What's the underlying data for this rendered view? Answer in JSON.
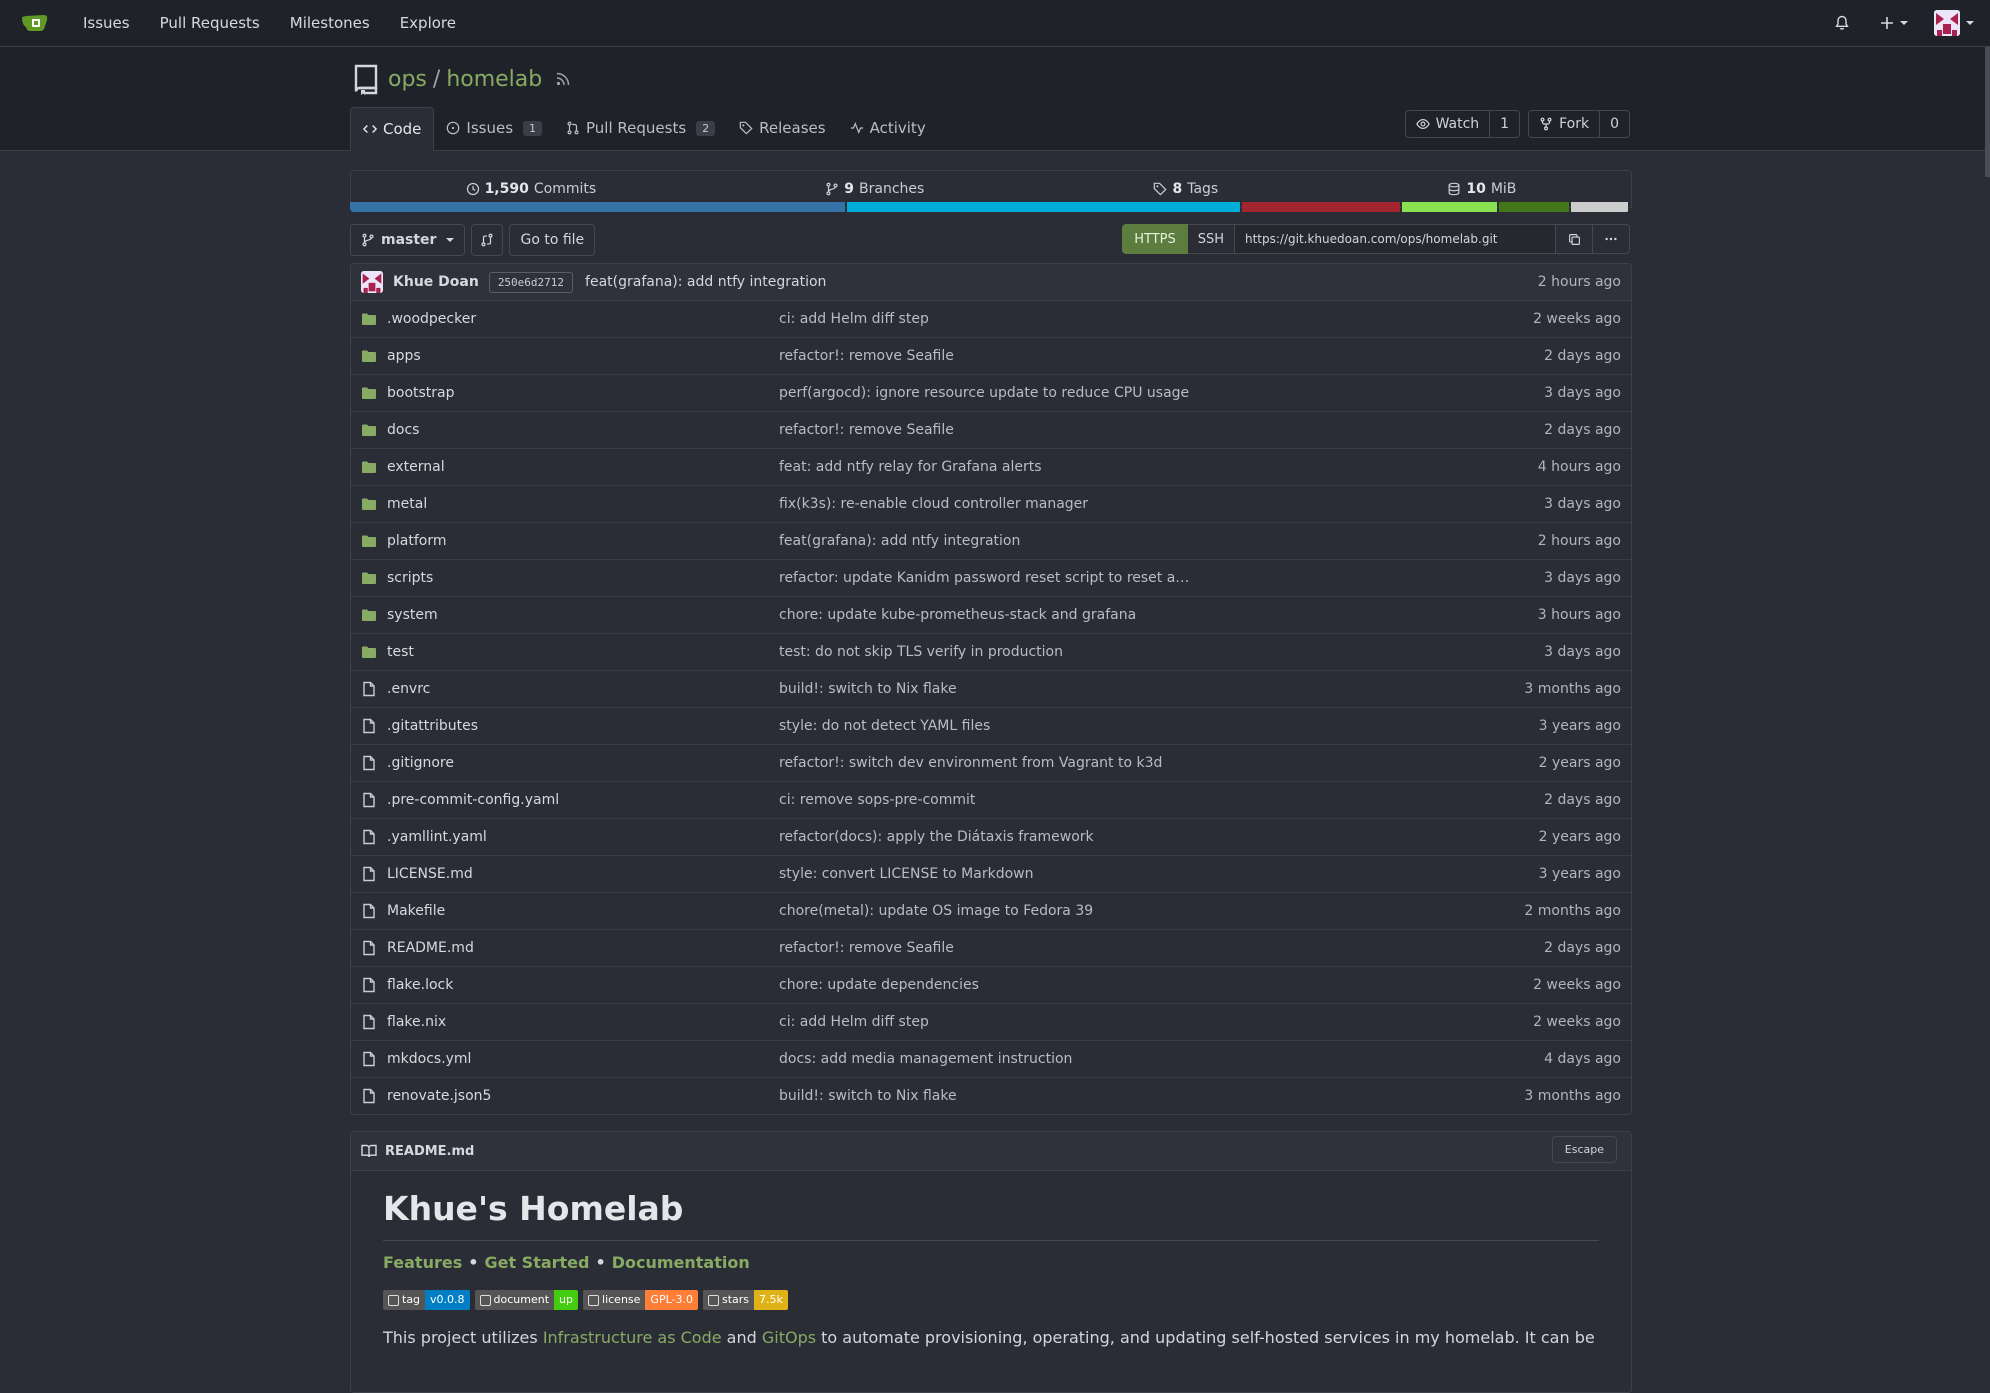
{
  "topnav": {
    "links": [
      "Issues",
      "Pull Requests",
      "Milestones",
      "Explore"
    ]
  },
  "repo": {
    "owner": "ops",
    "name": "homelab",
    "watch_label": "Watch",
    "watch_count": "1",
    "fork_label": "Fork",
    "fork_count": "0"
  },
  "tabs": {
    "code": "Code",
    "issues": "Issues",
    "issues_count": "1",
    "pulls": "Pull Requests",
    "pulls_count": "2",
    "releases": "Releases",
    "activity": "Activity"
  },
  "stats": {
    "commits_num": "1,590",
    "commits_label": "Commits",
    "branches_num": "9",
    "branches_label": "Branches",
    "tags_num": "8",
    "tags_label": "Tags",
    "size_num": "10",
    "size_label": "MiB"
  },
  "language_bar": [
    {
      "color": "#3572a5",
      "share": 39
    },
    {
      "color": "#00add8",
      "share": 31
    },
    {
      "color": "#a3252f",
      "share": 12.5
    },
    {
      "color": "#89e051",
      "share": 7.5
    },
    {
      "color": "#427819",
      "share": 5.5
    },
    {
      "color": "#cccccc",
      "share": 4.5
    }
  ],
  "toolbar": {
    "branch": "master",
    "goto_file": "Go to file",
    "https": "HTTPS",
    "ssh": "SSH",
    "clone_url": "https://git.khuedoan.com/ops/homelab.git"
  },
  "latest_commit": {
    "author": "Khue Doan",
    "sha": "250e6d2712",
    "message": "feat(grafana): add ntfy integration",
    "age": "2 hours ago"
  },
  "files": [
    {
      "name": ".woodpecker",
      "type": "dir",
      "message": "ci: add Helm diff step",
      "age": "2 weeks ago"
    },
    {
      "name": "apps",
      "type": "dir",
      "message": "refactor!: remove Seafile",
      "age": "2 days ago"
    },
    {
      "name": "bootstrap",
      "type": "dir",
      "message": "perf(argocd): ignore resource update to reduce CPU usage",
      "age": "3 days ago"
    },
    {
      "name": "docs",
      "type": "dir",
      "message": "refactor!: remove Seafile",
      "age": "2 days ago"
    },
    {
      "name": "external",
      "type": "dir",
      "message": "feat: add ntfy relay for Grafana alerts",
      "age": "4 hours ago"
    },
    {
      "name": "metal",
      "type": "dir",
      "message": "fix(k3s): re-enable cloud controller manager",
      "age": "3 days ago"
    },
    {
      "name": "platform",
      "type": "dir",
      "message": "feat(grafana): add ntfy integration",
      "age": "2 hours ago"
    },
    {
      "name": "scripts",
      "type": "dir",
      "message": "refactor: update Kanidm password reset script to reset a…",
      "age": "3 days ago"
    },
    {
      "name": "system",
      "type": "dir",
      "message": "chore: update kube-prometheus-stack and grafana",
      "age": "3 hours ago"
    },
    {
      "name": "test",
      "type": "dir",
      "message": "test: do not skip TLS verify in production",
      "age": "3 days ago"
    },
    {
      "name": ".envrc",
      "type": "file",
      "message": "build!: switch to Nix flake",
      "age": "3 months ago"
    },
    {
      "name": ".gitattributes",
      "type": "file",
      "message": "style: do not detect YAML files",
      "age": "3 years ago"
    },
    {
      "name": ".gitignore",
      "type": "file",
      "message": "refactor!: switch dev environment from Vagrant to k3d",
      "age": "2 years ago"
    },
    {
      "name": ".pre-commit-config.yaml",
      "type": "file",
      "message": "ci: remove sops-pre-commit",
      "age": "2 days ago"
    },
    {
      "name": ".yamllint.yaml",
      "type": "file",
      "message": "refactor(docs): apply the Diátaxis framework",
      "age": "2 years ago"
    },
    {
      "name": "LICENSE.md",
      "type": "file",
      "message": "style: convert LICENSE to Markdown",
      "age": "3 years ago"
    },
    {
      "name": "Makefile",
      "type": "file",
      "message": "chore(metal): update OS image to Fedora 39",
      "age": "2 months ago"
    },
    {
      "name": "README.md",
      "type": "file",
      "message": "refactor!: remove Seafile",
      "age": "2 days ago"
    },
    {
      "name": "flake.lock",
      "type": "file",
      "message": "chore: update dependencies",
      "age": "2 weeks ago"
    },
    {
      "name": "flake.nix",
      "type": "file",
      "message": "ci: add Helm diff step",
      "age": "2 weeks ago"
    },
    {
      "name": "mkdocs.yml",
      "type": "file",
      "message": "docs: add media management instruction",
      "age": "4 days ago"
    },
    {
      "name": "renovate.json5",
      "type": "file",
      "message": "build!: switch to Nix flake",
      "age": "3 months ago"
    }
  ],
  "readme": {
    "filename": "README.md",
    "escape": "Escape",
    "title": "Khue's Homelab",
    "links": [
      "Features",
      "Get Started",
      "Documentation"
    ],
    "separator": "•",
    "badges": [
      {
        "label": "tag",
        "value": "v0.0.8",
        "color": "#007ec6",
        "icon": "vercel-icon"
      },
      {
        "label": "document",
        "value": "up",
        "color": "#4c1",
        "icon": "book-icon"
      },
      {
        "label": "license",
        "value": "GPL-3.0",
        "color": "#fe7d37",
        "icon": "license-icon"
      },
      {
        "label": "stars",
        "value": "7.5k",
        "color": "#dfb317",
        "icon": "github-icon"
      }
    ],
    "intro_prefix": "This project utilizes ",
    "intro_link1": "Infrastructure as Code",
    "intro_mid": " and ",
    "intro_link2": "GitOps",
    "intro_suffix": " to automate provisioning, operating, and updating self-hosted services in my homelab. It can be"
  }
}
